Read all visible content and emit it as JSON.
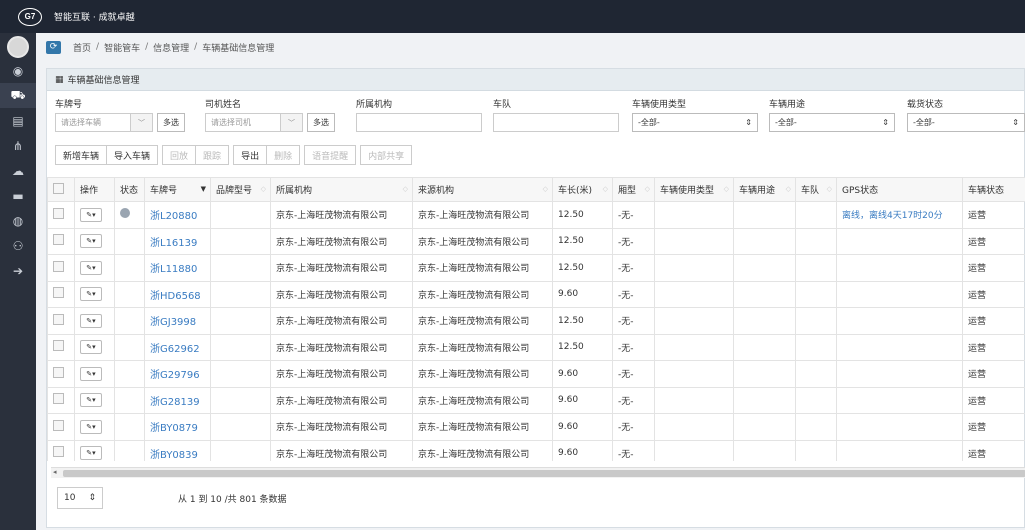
{
  "topbar": {
    "logo": "G7",
    "slogan": "智能互联 · 成就卓越"
  },
  "rail": {
    "items": [
      {
        "icon": "eye-icon",
        "glyph": "◉"
      },
      {
        "icon": "truck-icon",
        "glyph": "⛟"
      },
      {
        "icon": "chart-icon",
        "glyph": "▤"
      },
      {
        "icon": "org-tree-icon",
        "glyph": "⋔"
      },
      {
        "icon": "cloud-icon",
        "glyph": "☁"
      },
      {
        "icon": "folder-icon",
        "glyph": "▬"
      },
      {
        "icon": "device-icon",
        "glyph": "◍"
      },
      {
        "icon": "users-icon",
        "glyph": "⚇"
      },
      {
        "icon": "arrow-right-icon",
        "glyph": "➔"
      }
    ]
  },
  "breadcrumb": {
    "refresh_glyph": "⟳",
    "items": [
      "首页",
      "智能管车",
      "信息管理",
      "车辆基础信息管理"
    ],
    "sep": "/"
  },
  "panel": {
    "title": "车辆基础信息管理",
    "grid_glyph": "▦"
  },
  "filters": {
    "plate": {
      "label": "车牌号",
      "placeholder": "请选择车辆",
      "multi": "多选"
    },
    "driver": {
      "label": "司机姓名",
      "placeholder": "请选择司机",
      "multi": "多选"
    },
    "org": {
      "label": "所属机构"
    },
    "fleet": {
      "label": "车队"
    },
    "use_type": {
      "label": "车辆使用类型",
      "value": "-全部-"
    },
    "purpose": {
      "label": "车辆用途",
      "value": "-全部-"
    },
    "load": {
      "label": "载货状态",
      "value": "-全部-"
    },
    "caret": "﹀",
    "spin": "⇕"
  },
  "toolbar": {
    "add": "新增车辆",
    "import": "导入车辆",
    "rollback": "回放",
    "track": "跟踪",
    "export": "导出",
    "delete": "删除",
    "alarm": "语音提醒",
    "share": "内部共享"
  },
  "table": {
    "headers": {
      "op": "操作",
      "status": "状态",
      "plate": "车牌号",
      "brand": "品牌型号",
      "org": "所属机构",
      "source": "来源机构",
      "length": "车长(米)",
      "type": "厢型",
      "use_type": "车辆使用类型",
      "purpose": "车辆用途",
      "fleet": "车队",
      "gps": "GPS状态",
      "vstatus": "车辆状态"
    },
    "sort_glyph": "◇",
    "sort_active_glyph": "▼",
    "wrench_glyph": "✎▾",
    "rows": [
      {
        "plate": "浙L20880",
        "org": "京东-上海旺茂物流有限公司",
        "source": "京东-上海旺茂物流有限公司",
        "length": "12.50",
        "type": "-无-",
        "gps": "离线，离线4天17时20分",
        "vstatus": "运营",
        "dot": true
      },
      {
        "plate": "浙L16139",
        "org": "京东-上海旺茂物流有限公司",
        "source": "京东-上海旺茂物流有限公司",
        "length": "12.50",
        "type": "-无-",
        "gps": "",
        "vstatus": "运营",
        "dot": false
      },
      {
        "plate": "浙L11880",
        "org": "京东-上海旺茂物流有限公司",
        "source": "京东-上海旺茂物流有限公司",
        "length": "12.50",
        "type": "-无-",
        "gps": "",
        "vstatus": "运营",
        "dot": false
      },
      {
        "plate": "浙HD6568",
        "org": "京东-上海旺茂物流有限公司",
        "source": "京东-上海旺茂物流有限公司",
        "length": "9.60",
        "type": "-无-",
        "gps": "",
        "vstatus": "运营",
        "dot": false
      },
      {
        "plate": "浙GJ3998",
        "org": "京东-上海旺茂物流有限公司",
        "source": "京东-上海旺茂物流有限公司",
        "length": "12.50",
        "type": "-无-",
        "gps": "",
        "vstatus": "运营",
        "dot": false
      },
      {
        "plate": "浙G62962",
        "org": "京东-上海旺茂物流有限公司",
        "source": "京东-上海旺茂物流有限公司",
        "length": "12.50",
        "type": "-无-",
        "gps": "",
        "vstatus": "运营",
        "dot": false
      },
      {
        "plate": "浙G29796",
        "org": "京东-上海旺茂物流有限公司",
        "source": "京东-上海旺茂物流有限公司",
        "length": "9.60",
        "type": "-无-",
        "gps": "",
        "vstatus": "运营",
        "dot": false
      },
      {
        "plate": "浙G28139",
        "org": "京东-上海旺茂物流有限公司",
        "source": "京东-上海旺茂物流有限公司",
        "length": "9.60",
        "type": "-无-",
        "gps": "",
        "vstatus": "运营",
        "dot": false
      },
      {
        "plate": "浙BY0879",
        "org": "京东-上海旺茂物流有限公司",
        "source": "京东-上海旺茂物流有限公司",
        "length": "9.60",
        "type": "-无-",
        "gps": "",
        "vstatus": "运营",
        "dot": false
      },
      {
        "plate": "浙BY0839",
        "org": "京东-上海旺茂物流有限公司",
        "source": "京东-上海旺茂物流有限公司",
        "length": "9.60",
        "type": "-无-",
        "gps": "",
        "vstatus": "运营",
        "dot": false
      }
    ]
  },
  "scroll": {
    "left_glyph": "◂"
  },
  "pager": {
    "page_size": "10",
    "info": "从 1 到 10 /共 801 条数据"
  },
  "colors": {
    "topbar": "#1f2633",
    "rail": "#2a303c",
    "link": "#3a7cc2"
  }
}
